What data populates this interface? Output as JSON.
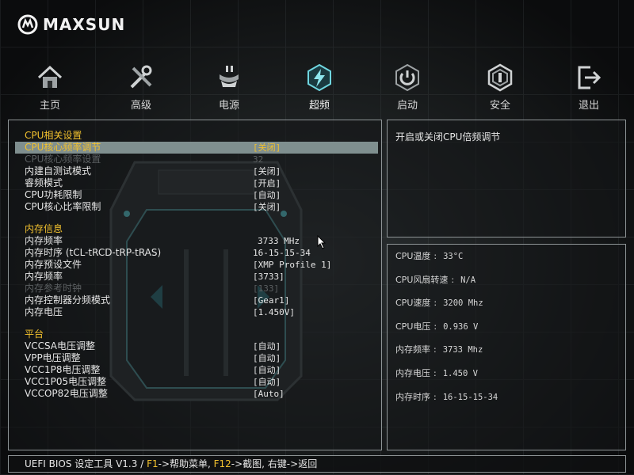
{
  "brand": {
    "name": "MAXSUN"
  },
  "nav": [
    {
      "label": "主页",
      "icon": "home-icon"
    },
    {
      "label": "高级",
      "icon": "tools-icon"
    },
    {
      "label": "电源",
      "icon": "power-plug-icon"
    },
    {
      "label": "超频",
      "icon": "lightning-icon",
      "active": true
    },
    {
      "label": "启动",
      "icon": "power-button-icon"
    },
    {
      "label": "安全",
      "icon": "shield-icon"
    },
    {
      "label": "退出",
      "icon": "exit-icon"
    }
  ],
  "settings": {
    "cpu_section": "CPU相关设置",
    "cpu_rows": [
      {
        "label": "CPU核心频率调节",
        "value": "[关闭]",
        "state": "selected"
      },
      {
        "label": "CPU核心频率设置",
        "value": "32",
        "state": "disabled"
      },
      {
        "label": "内建自测试模式",
        "value": "[关闭]",
        "state": "normal"
      },
      {
        "label": "睿频模式",
        "value": "[开启]",
        "state": "normal"
      },
      {
        "label": "CPU功耗限制",
        "value": "[自动]",
        "state": "normal"
      },
      {
        "label": "CPU核心比率限制",
        "value": "[关闭]",
        "state": "normal"
      }
    ],
    "memory_section": "内存信息",
    "memory_rows": [
      {
        "label": "内存频率",
        "value": "3733 MHz",
        "state": "readonly"
      },
      {
        "label": "内存时序 (tCL-tRCD-tRP-tRAS)",
        "value": "16-15-15-34",
        "state": "readonly"
      },
      {
        "label": "内存预设文件",
        "value": "[XMP Profile 1]",
        "state": "normal"
      },
      {
        "label": "内存频率",
        "value": "[3733]",
        "state": "normal"
      },
      {
        "label": "内存参考时钟",
        "value": "[133]",
        "state": "disabled"
      },
      {
        "label": "内存控制器分频模式",
        "value": "[Gear1]",
        "state": "normal"
      },
      {
        "label": "内存电压",
        "value": "[1.450V]",
        "state": "normal"
      }
    ],
    "platform_section": "平台",
    "platform_rows": [
      {
        "label": "VCCSA电压调整",
        "value": "[自动]",
        "state": "normal"
      },
      {
        "label": "VPP电压调整",
        "value": "[自动]",
        "state": "normal"
      },
      {
        "label": "VCC1P8电压调整",
        "value": "[自动]",
        "state": "normal"
      },
      {
        "label": "VCC1P05电压调整",
        "value": "[自动]",
        "state": "normal"
      },
      {
        "label": "VCCOP82电压调整",
        "value": "[Auto]",
        "state": "normal"
      }
    ]
  },
  "help": {
    "text": "开启或关闭CPU倍频调节"
  },
  "system_info": [
    {
      "key": "CPU温度",
      "value": "33°C"
    },
    {
      "key": "CPU风扇转速",
      "value": "N/A"
    },
    {
      "key": "CPU速度",
      "value": "3200 Mhz"
    },
    {
      "key": "CPU电压",
      "value": "0.936 V"
    },
    {
      "key": "内存频率",
      "value": "3733 Mhz"
    },
    {
      "key": "内存电压",
      "value": "1.450 V"
    },
    {
      "key": "内存时序",
      "value": "16-15-15-34"
    }
  ],
  "footer": {
    "prefix": "UEFI BIOS 设定工具 V1.3 / ",
    "f1_key": "F1",
    "f1_text": "->帮助菜单, ",
    "f12_key": "F12",
    "f12_text": "->截图, 右键->返回"
  },
  "colors": {
    "highlight": "#f2c12e",
    "selected_bg": "#7f8f8f",
    "border": "#8e9496"
  }
}
